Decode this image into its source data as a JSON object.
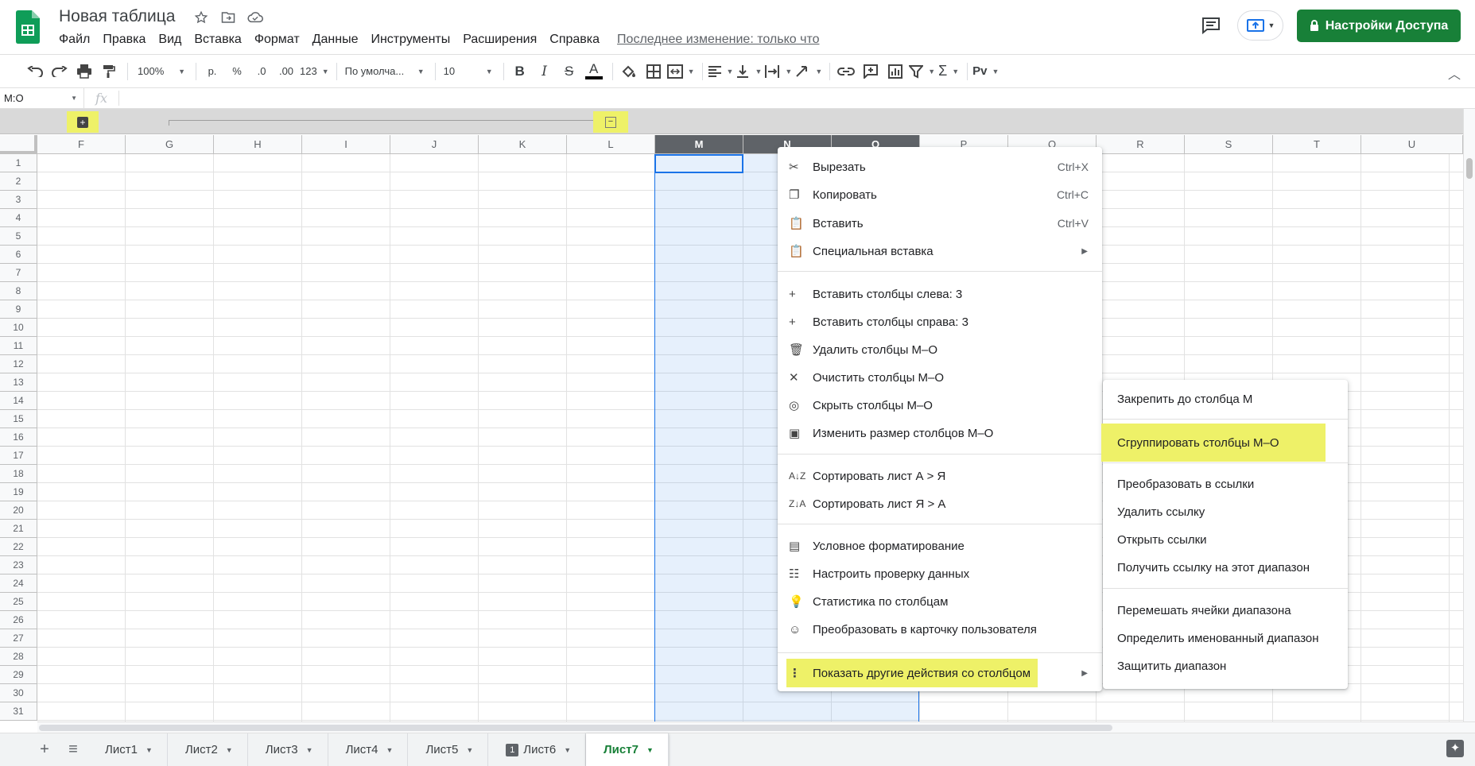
{
  "app": {
    "title": "Новая таблица",
    "menu": [
      "Файл",
      "Правка",
      "Вид",
      "Вставка",
      "Формат",
      "Данные",
      "Инструменты",
      "Расширения",
      "Справка"
    ],
    "last_edit": "Последнее изменение: только что",
    "share_label": "Настройки Доступа",
    "brand_color": "#188038"
  },
  "toolbar": {
    "zoom": "100%",
    "currency": "р.",
    "percent": "%",
    "dec_less": ".0",
    "dec_more": ".00",
    "format_more": "123",
    "font": "По умолча...",
    "font_size": "10",
    "bold": "B",
    "italic": "I",
    "strike": "S",
    "text_color": "A",
    "input_tools": "Pv"
  },
  "formula": {
    "name_box": "M:O",
    "fx": "fx",
    "value": ""
  },
  "grid": {
    "columns": [
      "F",
      "G",
      "H",
      "I",
      "J",
      "K",
      "L",
      "M",
      "N",
      "O",
      "P",
      "Q",
      "R",
      "S",
      "T",
      "U"
    ],
    "selected_columns": [
      "M",
      "N",
      "O"
    ],
    "rows": [
      "1",
      "2",
      "3",
      "4",
      "5",
      "6",
      "7",
      "8",
      "9",
      "10",
      "11",
      "12",
      "13",
      "14",
      "15",
      "16",
      "17",
      "18",
      "19",
      "20",
      "21",
      "22",
      "23",
      "24",
      "25",
      "26",
      "27",
      "28",
      "29",
      "30",
      "31"
    ]
  },
  "grouping": {
    "expand_symbol": "+",
    "collapse_symbol": "−"
  },
  "sheets": {
    "tabs": [
      "Лист1",
      "Лист2",
      "Лист3",
      "Лист4",
      "Лист5",
      "Лист6",
      "Лист7"
    ],
    "active": "Лист7",
    "add_symbol": "+",
    "list_symbol": "≡"
  },
  "context_menu": {
    "cut": {
      "label": "Вырезать",
      "shortcut": "Ctrl+X"
    },
    "copy": {
      "label": "Копировать",
      "shortcut": "Ctrl+C"
    },
    "paste": {
      "label": "Вставить",
      "shortcut": "Ctrl+V"
    },
    "paste_special": {
      "label": "Специальная вставка"
    },
    "insert_left": {
      "label": "Вставить столбцы слева: 3"
    },
    "insert_right": {
      "label": "Вставить столбцы справа: 3"
    },
    "delete_cols": {
      "label": "Удалить столбцы M–O"
    },
    "clear_cols": {
      "label": "Очистить столбцы M–O"
    },
    "hide_cols": {
      "label": "Скрыть столбцы M–O"
    },
    "resize_cols": {
      "label": "Изменить размер столбцов M–O"
    },
    "sort_az": {
      "label": "Сортировать лист А > Я"
    },
    "sort_za": {
      "label": "Сортировать лист Я > А"
    },
    "cond_format": {
      "label": "Условное форматирование"
    },
    "validation": {
      "label": "Настроить проверку данных"
    },
    "column_stats": {
      "label": "Статистика по столбцам"
    },
    "people_chip": {
      "label": "Преобразовать в карточку пользователя"
    },
    "more_actions": {
      "label": "Показать другие действия со столбцом"
    }
  },
  "submenu": {
    "freeze": "Закрепить до столбца M",
    "group": "Сгруппировать столбцы M–O",
    "to_links": "Преобразовать в ссылки",
    "remove_link": "Удалить ссылку",
    "open_links": "Открыть ссылки",
    "get_link": "Получить ссылку на этот диапазон",
    "randomize": "Перемешать ячейки диапазона",
    "named_range": "Определить именованный диапазон",
    "protect": "Защитить диапазон"
  },
  "highlight_color": "#eef168"
}
